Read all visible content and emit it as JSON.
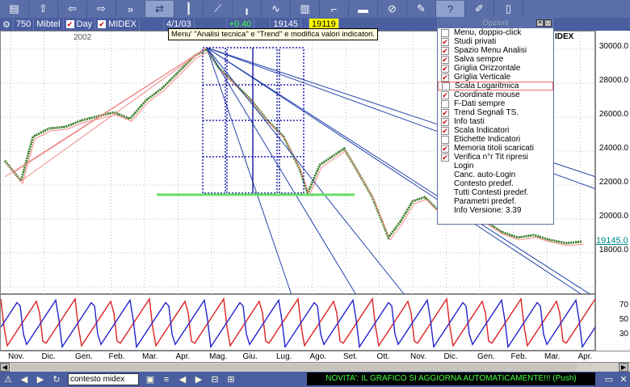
{
  "toolbar": {
    "icons": [
      "layout-icon",
      "home-icon",
      "back-icon",
      "forward-icon",
      "fast-forward-icon",
      "compare-icon",
      "candles-icon",
      "trendlines-icon",
      "bars-icon",
      "line-chart-icon",
      "volume-icon",
      "step-icon",
      "bar-pattern-icon",
      "stop-icon",
      "pen-icon",
      "help-icon",
      "brush-icon",
      "scale-icon"
    ]
  },
  "infobar": {
    "code": "750",
    "name": "Mibtel",
    "period": "Day",
    "index": "MIDEX",
    "date": "4/1/03",
    "change": "+0.40",
    "value1": "19145",
    "value2": "19119"
  },
  "chart": {
    "year_label": "2002",
    "index_label": "IDEX",
    "y_ticks": [
      "30000.0",
      "28000.0",
      "26000.0",
      "24000.0",
      "22000.0",
      "20000.0",
      "18000.0"
    ],
    "last_price": "19145.0",
    "osc_ticks": [
      "70",
      "50",
      "30"
    ],
    "months": [
      "Nov.",
      "Dic.",
      "Gen.",
      "Feb.",
      "Mar.",
      "Apr.",
      "Mag.",
      "Giu.",
      "Lug.",
      "Ago.",
      "Set.",
      "Ott.",
      "Nov.",
      "Dic.",
      "Gen.",
      "Feb.",
      "Mar.",
      "Apr."
    ]
  },
  "tooltip": "Menu' \"Analisi tecnica\" e \"Trend\" e modifica valori indicatori.",
  "options": {
    "title": "Opzioni",
    "items": [
      {
        "label": "Menu, doppio-click",
        "checked": false,
        "box": true
      },
      {
        "label": "Studi privati",
        "checked": true,
        "box": true
      },
      {
        "label": "Spazio Menu Analisi",
        "checked": true,
        "box": true
      },
      {
        "label": "Salva sempre",
        "checked": true,
        "box": true
      },
      {
        "label": "Griglia Orizzontale",
        "checked": true,
        "box": true
      },
      {
        "label": "Griglia Verticale",
        "checked": true,
        "box": true
      },
      {
        "label": "Scala Logaritmica",
        "checked": false,
        "box": true,
        "highlight": true
      },
      {
        "label": "Coordinate mouse",
        "checked": true,
        "box": true
      },
      {
        "label": "F-Dati sempre",
        "checked": false,
        "box": true
      },
      {
        "label": "Trend Segnali TS.",
        "checked": true,
        "box": true
      },
      {
        "label": "Info tasti",
        "checked": true,
        "box": true
      },
      {
        "label": "Scala Indicatori",
        "checked": true,
        "box": true
      },
      {
        "label": "Etichette Indicatori",
        "checked": false,
        "box": true
      },
      {
        "label": "Memoria titoli scaricati",
        "checked": true,
        "box": true
      },
      {
        "label": "Verifica n°r Tit ripresi",
        "checked": true,
        "box": true
      },
      {
        "label": "Login",
        "checked": false,
        "box": false
      },
      {
        "label": "Canc. auto-Login",
        "checked": false,
        "box": false
      },
      {
        "label": "Contesto predef.",
        "checked": false,
        "box": false
      },
      {
        "label": "Tutti Contesti predef.",
        "checked": false,
        "box": false
      },
      {
        "label": "Parametri predef.",
        "checked": false,
        "box": false
      },
      {
        "label": "Info Versione: 3.39",
        "checked": false,
        "box": false
      }
    ]
  },
  "bottom": {
    "context": "contesto midex",
    "ticker": "NOVITA': IL GRAFICO SI AGGIORNA AUTOMATICAMENTE!!! (Push)"
  }
}
